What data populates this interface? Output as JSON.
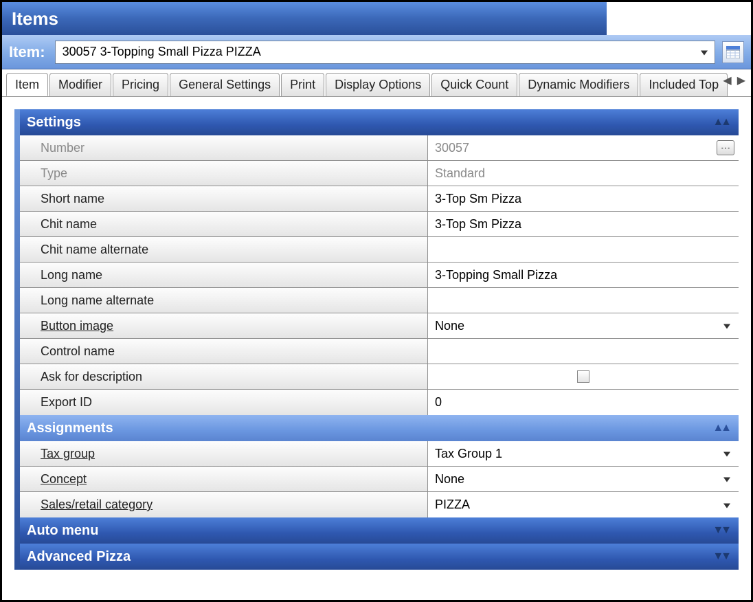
{
  "title": "Items",
  "selector": {
    "label": "Item:",
    "value": "30057 3-Topping Small Pizza PIZZA"
  },
  "tabs": [
    "Item",
    "Modifier",
    "Pricing",
    "General Settings",
    "Print",
    "Display Options",
    "Quick Count",
    "Dynamic Modifiers",
    "Included Top"
  ],
  "active_tab_index": 0,
  "sections": {
    "settings": {
      "title": "Settings",
      "expanded": true,
      "rows": [
        {
          "label": "Number",
          "value": "30057",
          "disabled": true,
          "ellipsis": true
        },
        {
          "label": "Type",
          "value": "Standard",
          "disabled": true
        },
        {
          "label": "Short name",
          "value": "3-Top Sm Pizza"
        },
        {
          "label": "Chit name",
          "value": "3-Top Sm Pizza"
        },
        {
          "label": "Chit name alternate",
          "value": ""
        },
        {
          "label": "Long name",
          "value": "3-Topping Small Pizza"
        },
        {
          "label": "Long name alternate",
          "value": ""
        },
        {
          "label": "Button image",
          "value": "None",
          "underline": true,
          "dropdown": true
        },
        {
          "label": "Control name",
          "value": ""
        },
        {
          "label": "Ask for description",
          "checkbox": true,
          "checked": false
        },
        {
          "label": "Export ID",
          "value": "0"
        }
      ]
    },
    "assignments": {
      "title": "Assignments",
      "expanded": true,
      "rows": [
        {
          "label": "Tax group",
          "value": "Tax Group 1",
          "underline": true,
          "dropdown": true
        },
        {
          "label": "Concept",
          "value": "None",
          "underline": true,
          "dropdown": true
        },
        {
          "label": "Sales/retail category",
          "value": "PIZZA",
          "underline": true,
          "dropdown": true
        }
      ]
    },
    "automenu": {
      "title": "Auto menu",
      "expanded": false
    },
    "advanced": {
      "title": "Advanced Pizza",
      "expanded": false
    }
  }
}
